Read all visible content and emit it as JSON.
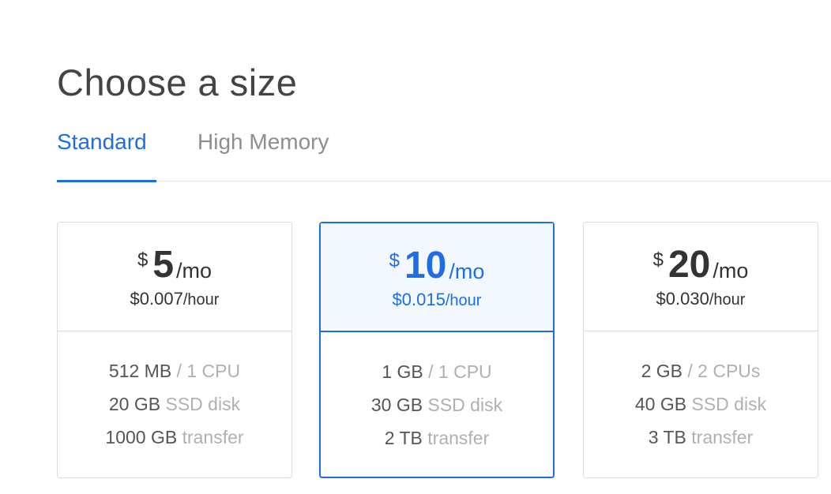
{
  "page": {
    "title": "Choose a size"
  },
  "tabs": [
    {
      "label": "Standard",
      "active": true
    },
    {
      "label": "High Memory",
      "active": false
    }
  ],
  "colors": {
    "accent": "#1d6ee6",
    "selected_background": "#f3f8fe",
    "border": "#dcdcdc",
    "muted_text": "#b0b0b0"
  },
  "plans": [
    {
      "currency": "$",
      "amount": "5",
      "per_month": "/mo",
      "hourly_price": "$0.007",
      "per_hour": "/hour",
      "selected": false,
      "memory": "512 MB",
      "cpu": " / 1 CPU",
      "disk": "20 GB",
      "disk_label": " SSD disk",
      "transfer": "1000 GB",
      "transfer_label": " transfer"
    },
    {
      "currency": "$",
      "amount": "10",
      "per_month": "/mo",
      "hourly_price": "$0.015",
      "per_hour": "/hour",
      "selected": true,
      "memory": "1 GB",
      "cpu": " / 1 CPU",
      "disk": "30 GB",
      "disk_label": " SSD disk",
      "transfer": "2 TB",
      "transfer_label": " transfer"
    },
    {
      "currency": "$",
      "amount": "20",
      "per_month": "/mo",
      "hourly_price": "$0.030",
      "per_hour": "/hour",
      "selected": false,
      "memory": "2 GB",
      "cpu": " / 2 CPUs",
      "disk": "40 GB",
      "disk_label": " SSD disk",
      "transfer": "3 TB",
      "transfer_label": " transfer"
    }
  ]
}
